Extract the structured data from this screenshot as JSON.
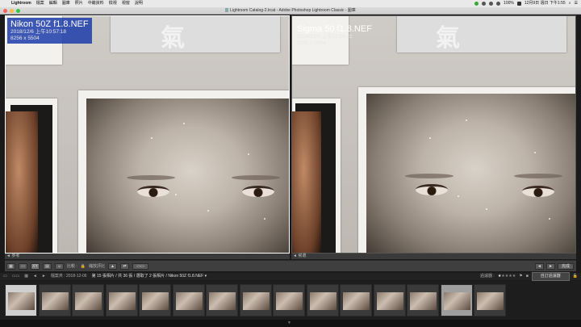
{
  "menubar": {
    "app": "Lightroom",
    "items": [
      "檔案",
      "編輯",
      "圖庫",
      "照片",
      "中繼資料",
      "檢視",
      "視窗",
      "說明"
    ],
    "battery": "100%",
    "clock": "12月9日 週日 下午1:55"
  },
  "window": {
    "title": "Lightroom Catalog-2.lrcat - Adobe Photoshop Lightroom Classic - 圖庫"
  },
  "compare": {
    "left": {
      "tag": "",
      "badge": "",
      "filename": "Nikon 50Z f1.8.NEF",
      "datetime": "2018/12/6 上午10:57:18",
      "dimensions": "8256 x 5504",
      "footer": "◄ 參考"
    },
    "right": {
      "tag": "候選",
      "filename": "Sigma 50 f1.8.NEF",
      "datetime": "2018/12/6 上午11:04:22",
      "dimensions": "8256 x 5504",
      "footer": "◄ 候選"
    }
  },
  "toolbar": {
    "compare_label": "比較 :",
    "zoom_label": "縮放評比",
    "done_label": "完成"
  },
  "strip": {
    "path": "檔案夾 : 2018-12-06",
    "count": "第 15 張相片 / 共 36 張 / 選取了 2 張相片 / Nikon 50Z f1.8.NEF ▾",
    "filter_label": "過濾器 :",
    "filter_value": "自訂過濾器",
    "rating": 1
  },
  "thumbs": 15
}
